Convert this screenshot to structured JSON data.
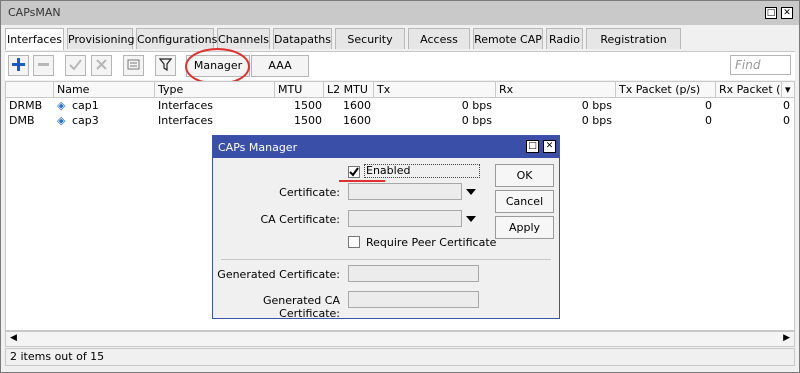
{
  "window": {
    "title": "CAPsMAN",
    "restore_glyph": "□",
    "close_glyph": "✕"
  },
  "tabs": [
    {
      "label": "Interfaces",
      "active": true
    },
    {
      "label": "Provisioning"
    },
    {
      "label": "Configurations"
    },
    {
      "label": "Channels"
    },
    {
      "label": "Datapaths"
    },
    {
      "label": "Security Cfg."
    },
    {
      "label": "Access List"
    },
    {
      "label": "Remote CAP"
    },
    {
      "label": "Radio"
    },
    {
      "label": "Registration Table"
    }
  ],
  "toolbar": {
    "icons": [
      "add-icon",
      "remove-icon",
      "enable-icon",
      "disable-icon",
      "comment-icon",
      "filter-icon"
    ],
    "manager_label": "Manager",
    "aaa_label": "AAA",
    "find_placeholder": "Find"
  },
  "table": {
    "columns": [
      "Name",
      "Type",
      "MTU",
      "L2 MTU",
      "Tx",
      "Rx",
      "Tx Packet (p/s)",
      "Rx Packet (p"
    ],
    "rows": [
      {
        "flag": "DRMB",
        "name": "cap1",
        "type": "Interfaces",
        "mtu": "1500",
        "l2mtu": "1600",
        "tx": "0 bps",
        "rx": "0 bps",
        "txp": "0",
        "rxp": "0"
      },
      {
        "flag": "DMB",
        "name": "cap3",
        "type": "Interfaces",
        "mtu": "1500",
        "l2mtu": "1600",
        "tx": "0 bps",
        "rx": "0 bps",
        "txp": "0",
        "rxp": "0"
      }
    ]
  },
  "status": {
    "text": "2 items out of 15"
  },
  "dialog": {
    "title": "CAPs Manager",
    "enabled_label": "Enabled",
    "enabled_checked": true,
    "certificate_label": "Certificate:",
    "ca_certificate_label": "CA Certificate:",
    "require_peer_label": "Require Peer Certificate",
    "generated_certificate_label": "Generated Certificate:",
    "generated_ca_certificate_label": "Generated CA Certificate:",
    "ok_label": "OK",
    "cancel_label": "Cancel",
    "apply_label": "Apply"
  },
  "colors": {
    "dialog_title_bar": "#3a50a8",
    "annotation": "#e03030",
    "add_icon": "#1a5bc4"
  }
}
